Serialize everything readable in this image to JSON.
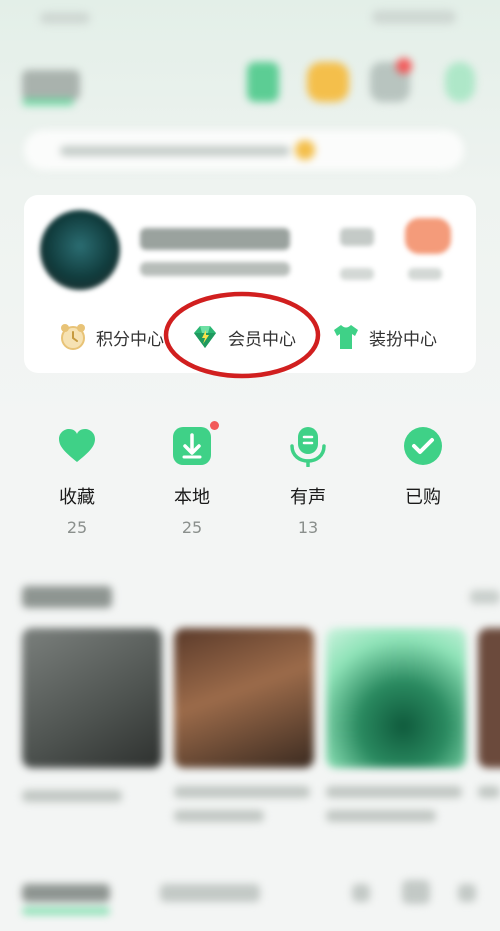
{
  "card_links": [
    {
      "label": "积分中心",
      "icon": "points-clock-icon"
    },
    {
      "label": "会员中心",
      "icon": "vip-diamond-icon"
    },
    {
      "label": "装扮中心",
      "icon": "tshirt-icon"
    }
  ],
  "quick_access": [
    {
      "label": "收藏",
      "count": "25",
      "icon": "heart-icon"
    },
    {
      "label": "本地",
      "count": "25",
      "icon": "download-icon"
    },
    {
      "label": "有声",
      "count": "13",
      "icon": "microphone-icon"
    },
    {
      "label": "已购",
      "count": "",
      "icon": "check-icon"
    }
  ],
  "colors": {
    "accent_green": "#3fd187",
    "highlight_ring": "#d11f1f",
    "badge_red": "#f25a5a"
  }
}
